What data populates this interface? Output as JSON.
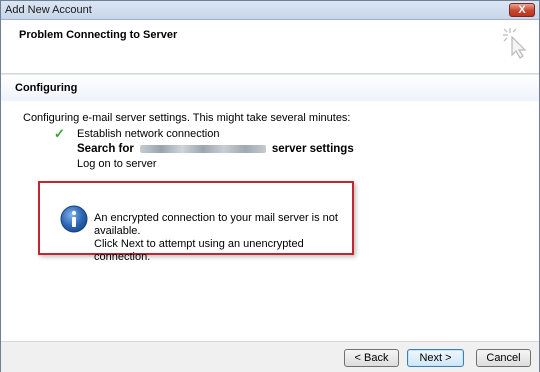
{
  "window": {
    "title": "Add New Account",
    "close_label": "X"
  },
  "header": {
    "title": "Problem Connecting to Server"
  },
  "section": {
    "title": "Configuring"
  },
  "body": {
    "intro": "Configuring e-mail server settings. This might take several minutes:",
    "steps": [
      {
        "label": "Establish network connection",
        "status": "done"
      },
      {
        "prefix": "Search for",
        "suffix": "server settings",
        "status": "current"
      },
      {
        "label": "Log on to server",
        "status": "pending"
      }
    ],
    "message": {
      "line1": "An encrypted connection to your mail server is not available.",
      "line2": "Click Next to attempt using an unencrypted connection.",
      "icon": "info-icon"
    }
  },
  "buttons": {
    "back": "< Back",
    "next": "Next >",
    "cancel": "Cancel"
  },
  "colors": {
    "highlight_border": "#c3262e",
    "check": "#3aa23a",
    "info_blue": "#2d67b6"
  }
}
